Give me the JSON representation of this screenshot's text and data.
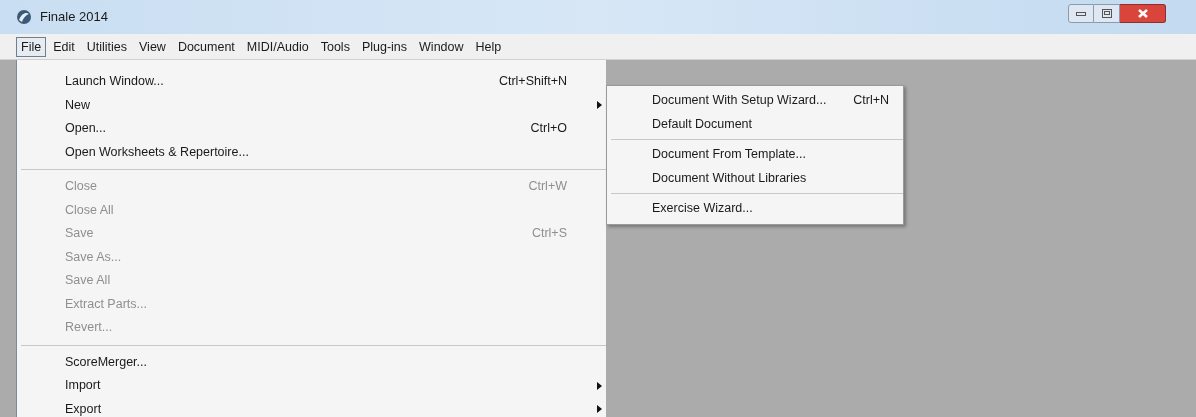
{
  "window": {
    "title": "Finale 2014"
  },
  "menu_bar": [
    {
      "label": "File",
      "selected": true
    },
    {
      "label": "Edit",
      "selected": false
    },
    {
      "label": "Utilities",
      "selected": false
    },
    {
      "label": "View",
      "selected": false
    },
    {
      "label": "Document",
      "selected": false
    },
    {
      "label": "MIDI/Audio",
      "selected": false
    },
    {
      "label": "Tools",
      "selected": false
    },
    {
      "label": "Plug-ins",
      "selected": false
    },
    {
      "label": "Window",
      "selected": false
    },
    {
      "label": "Help",
      "selected": false
    }
  ],
  "file_menu": {
    "sections": [
      [
        {
          "label": "Launch Window...",
          "shortcut": "Ctrl+Shift+N",
          "disabled": false,
          "submenu": false
        },
        {
          "label": "New",
          "disabled": false,
          "submenu": true
        },
        {
          "label": "Open...",
          "shortcut": "Ctrl+O",
          "disabled": false,
          "submenu": false
        },
        {
          "label": "Open Worksheets & Repertoire...",
          "disabled": false,
          "submenu": false
        }
      ],
      [
        {
          "label": "Close",
          "shortcut": "Ctrl+W",
          "disabled": true,
          "submenu": false
        },
        {
          "label": "Close All",
          "disabled": true,
          "submenu": false
        },
        {
          "label": "Save",
          "shortcut": "Ctrl+S",
          "disabled": true,
          "submenu": false
        },
        {
          "label": "Save As...",
          "disabled": true,
          "submenu": false
        },
        {
          "label": "Save All",
          "disabled": true,
          "submenu": false
        },
        {
          "label": "Extract Parts...",
          "disabled": true,
          "submenu": false
        },
        {
          "label": "Revert...",
          "disabled": true,
          "submenu": false
        }
      ],
      [
        {
          "label": "ScoreMerger...",
          "disabled": false,
          "submenu": false
        },
        {
          "label": "Import",
          "disabled": false,
          "submenu": true
        },
        {
          "label": "Export",
          "disabled": false,
          "submenu": true
        }
      ]
    ]
  },
  "new_submenu": {
    "sections": [
      [
        {
          "label": "Document With Setup Wizard...",
          "shortcut": "Ctrl+N"
        },
        {
          "label": "Default Document"
        }
      ],
      [
        {
          "label": "Document From Template..."
        },
        {
          "label": "Document Without Libraries"
        }
      ],
      [
        {
          "label": "Exercise Wizard..."
        }
      ]
    ]
  }
}
